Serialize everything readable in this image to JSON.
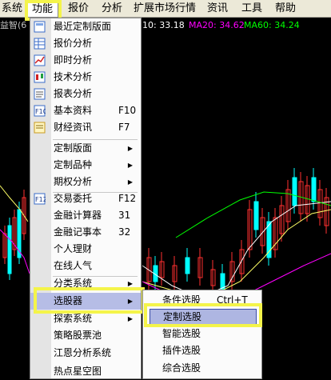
{
  "menubar": {
    "items": [
      "系统",
      "功能",
      "报价",
      "分析",
      "扩展市场行情",
      "资讯",
      "工具",
      "帮助"
    ],
    "active_index": 1
  },
  "chart_header": {
    "title": "益智(6",
    "value_text": "10: 33.18",
    "ma20_text": "MA20: 34.62",
    "ma60_text": "MA60: 34.24",
    "colors": {
      "ma10": "#ffffff",
      "ma20": "#ff00ff",
      "ma60": "#00ff00"
    }
  },
  "main_menu": {
    "items": [
      {
        "label": "最近定制版面",
        "icon": "layout-icon"
      },
      {
        "label": "报价分析",
        "icon": "table-icon"
      },
      {
        "label": "即时分析",
        "icon": "line-chart-icon"
      },
      {
        "label": "技术分析",
        "icon": "candlestick-icon"
      },
      {
        "label": "报表分析",
        "icon": "report-icon"
      },
      {
        "label": "基本资料",
        "shortcut": "F10",
        "icon": "f10-icon"
      },
      {
        "label": "财经资讯",
        "shortcut": "F7",
        "icon": "news-icon"
      },
      {
        "label": "定制版面",
        "submenu": true
      },
      {
        "label": "定制品种",
        "submenu": true
      },
      {
        "label": "期权分析",
        "submenu": true
      },
      {
        "label": "交易委托",
        "shortcut": "F12",
        "icon": "f12-icon"
      },
      {
        "label": "金融计算器",
        "shortcut": "31"
      },
      {
        "label": "金融记事本",
        "shortcut": "32"
      },
      {
        "label": "个人理财"
      },
      {
        "label": "在线人气"
      },
      {
        "label": "分类系统",
        "submenu": true
      },
      {
        "label": "选股器",
        "submenu": true
      },
      {
        "label": "探索系统",
        "submenu": true
      },
      {
        "label": "策略股票池"
      },
      {
        "label": "江恩分析系统"
      },
      {
        "label": "热点星空图"
      }
    ]
  },
  "sub_menu": {
    "items": [
      {
        "label": "条件选股",
        "shortcut": "Ctrl+T"
      },
      {
        "label": "定制选股"
      },
      {
        "label": "智能选股"
      },
      {
        "label": "插件选股"
      },
      {
        "label": "综合选股"
      }
    ]
  }
}
